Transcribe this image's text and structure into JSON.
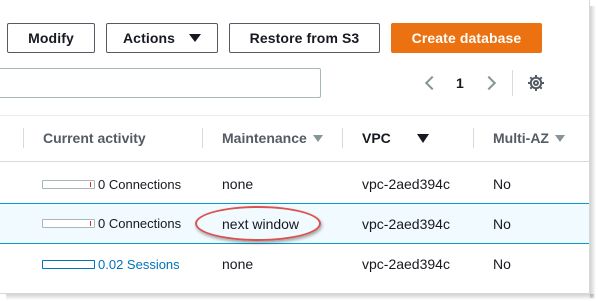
{
  "toolbar": {
    "modify_label": "Modify",
    "actions_label": "Actions",
    "restore_label": "Restore from S3",
    "create_label": "Create database"
  },
  "search": {
    "value": "",
    "placeholder": ""
  },
  "pagination": {
    "current_page": "1"
  },
  "columns": [
    {
      "label": "Current activity",
      "sortable": false,
      "sorted": false
    },
    {
      "label": "Maintenance",
      "sortable": true,
      "sorted": false
    },
    {
      "label": "VPC",
      "sortable": true,
      "sorted": true
    },
    {
      "label": "Multi-AZ",
      "sortable": true,
      "sorted": false
    }
  ],
  "rows": [
    {
      "activity": "0 Connections",
      "activity_is_link": false,
      "maintenance": "none",
      "vpc": "vpc-2aed394c",
      "multi_az": "No",
      "selected": false
    },
    {
      "activity": "0 Connections",
      "activity_is_link": false,
      "maintenance": "next window",
      "vpc": "vpc-2aed394c",
      "multi_az": "No",
      "selected": true
    },
    {
      "activity": "0.02 Sessions",
      "activity_is_link": true,
      "maintenance": "none",
      "vpc": "vpc-2aed394c",
      "multi_az": "No",
      "selected": false
    }
  ],
  "icons": {
    "actions_dropdown": "caret-down-icon",
    "prev_page": "chevron-left-icon",
    "next_page": "chevron-right-icon",
    "settings": "gear-icon",
    "sort": "caret-down-icon"
  },
  "colors": {
    "primary_button": "#ec7211",
    "selected_row_bg": "#f1faff",
    "selected_row_border": "#00a1c9",
    "link": "#0073bb",
    "annotation_oval": "#d9534f"
  }
}
